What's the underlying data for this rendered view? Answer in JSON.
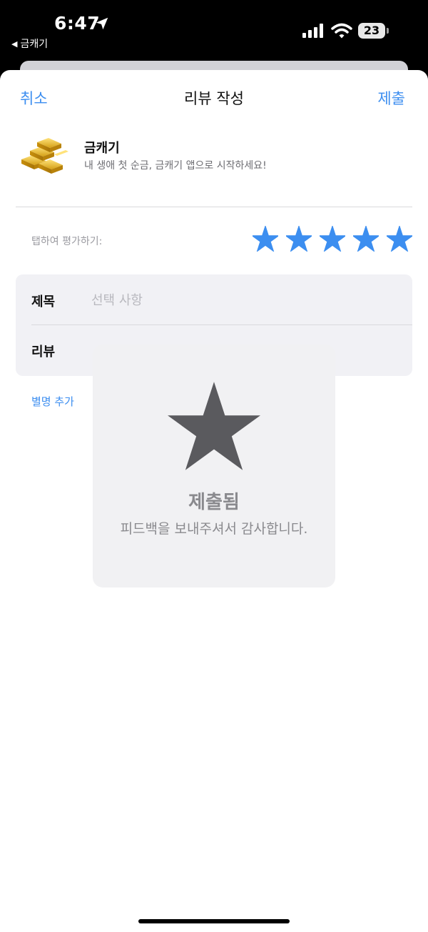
{
  "status_bar": {
    "time": "6:47",
    "back_app": "금캐기",
    "battery": "23"
  },
  "nav": {
    "cancel": "취소",
    "title": "리뷰 작성",
    "submit": "제출"
  },
  "app": {
    "name": "금캐기",
    "subtitle": "내 생애 첫 순금, 금캐기 앱으로 시작하세요!"
  },
  "rating": {
    "label": "탭하여 평가하기:",
    "stars": 5,
    "max": 5,
    "color": "#3c8ef0"
  },
  "form": {
    "title_label": "제목",
    "title_placeholder": "선택 사항",
    "review_label": "리뷰"
  },
  "nickname_link": "별명 추가",
  "hud": {
    "icon": "star-icon",
    "title": "제출됨",
    "message": "피드백을 보내주셔서 감사합니다."
  }
}
